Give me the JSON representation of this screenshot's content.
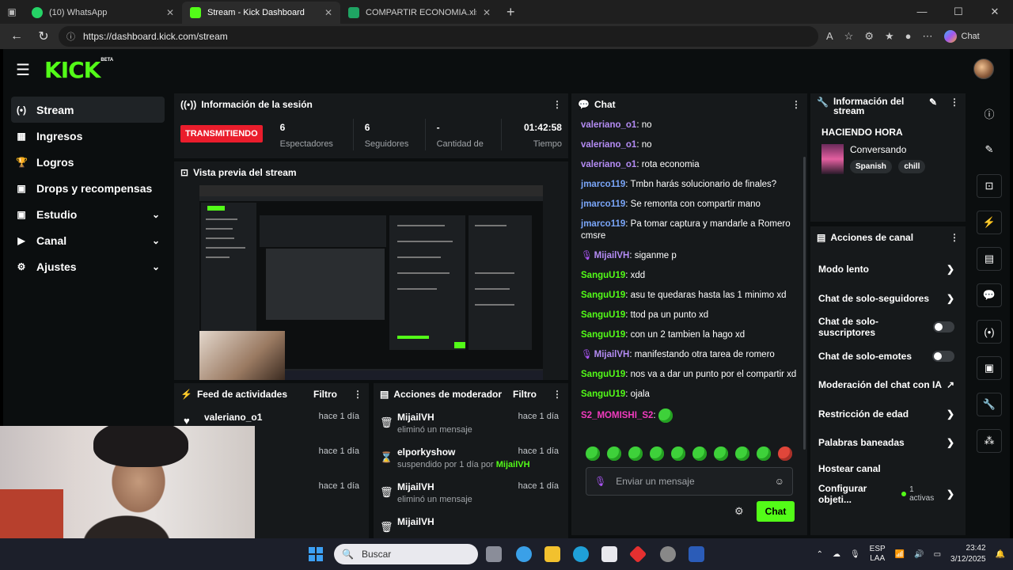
{
  "browser": {
    "tabs": [
      {
        "label": "(10) WhatsApp",
        "color": "#25d366"
      },
      {
        "label": "Stream - Kick Dashboard",
        "color": "#53fc18"
      },
      {
        "label": "COMPARTIR ECONOMIA.xlsx - Ho",
        "color": "#1fa463"
      }
    ],
    "url": "https://dashboard.kick.com/stream",
    "copilot_label": "Chat"
  },
  "kick": {
    "logo": "KICK",
    "beta": "BETA",
    "sidebar": [
      {
        "label": "Stream",
        "icon": "broadcast-icon",
        "glyph": "(•)"
      },
      {
        "label": "Ingresos",
        "icon": "wallet-icon",
        "glyph": "▦"
      },
      {
        "label": "Logros",
        "icon": "trophy-icon",
        "glyph": "🏆"
      },
      {
        "label": "Drops y recompensas",
        "icon": "gift-icon",
        "glyph": "▣"
      },
      {
        "label": "Estudio",
        "icon": "studio-icon",
        "glyph": "▣"
      },
      {
        "label": "Canal",
        "icon": "channel-icon",
        "glyph": "▶"
      },
      {
        "label": "Ajustes",
        "icon": "gear-icon",
        "glyph": "⚙"
      }
    ],
    "session": {
      "title": "Información de la sesión",
      "status": "TRANSMITIENDO",
      "stats": [
        {
          "value": "6",
          "label": "Espectadores"
        },
        {
          "value": "6",
          "label": "Seguidores"
        },
        {
          "value": "-",
          "label": "Cantidad de"
        },
        {
          "value": "01:42:58",
          "label": "Tiempo"
        }
      ]
    },
    "preview": {
      "title": "Vista previa del stream"
    },
    "activity": {
      "title": "Feed de actividades",
      "filter": "Filtro",
      "rows": [
        {
          "who": "valeriano_o1",
          "what": "uir el canal",
          "when": "hace 1 día"
        },
        {
          "who": "",
          "what": "uir el canal",
          "when": "hace 1 día"
        },
        {
          "who": "",
          "what": "uir el canal",
          "when": "hace 1 día"
        },
        {
          "who": "seguidores",
          "what": "",
          "when": ""
        }
      ]
    },
    "modactions": {
      "title": "Acciones de moderador",
      "filter": "Filtro",
      "rows": [
        {
          "who": "MijailVH",
          "what": "eliminó un mensaje",
          "by": "",
          "when": "hace 1 día",
          "icon": "trash-icon",
          "glyph": "🗑"
        },
        {
          "who": "elporkyshow",
          "what": "suspendido por 1 día por ",
          "by": "MijailVH",
          "when": "hace 1 día",
          "icon": "hourglass-icon",
          "glyph": "⌛"
        },
        {
          "who": "MijailVH",
          "what": "eliminó un mensaje",
          "by": "",
          "when": "hace 1 día",
          "icon": "trash-icon",
          "glyph": "🗑"
        },
        {
          "who": "MijailVH",
          "what": "",
          "by": "",
          "when": "",
          "icon": "trash-icon",
          "glyph": "🗑"
        }
      ]
    },
    "chat": {
      "title": "Chat",
      "messages": [
        {
          "user": "valeriano_o1",
          "color": "purple",
          "text": "no",
          "mic": false
        },
        {
          "user": "valeriano_o1",
          "color": "purple",
          "text": "no",
          "mic": false
        },
        {
          "user": "valeriano_o1",
          "color": "purple",
          "text": "rota economia",
          "mic": false
        },
        {
          "user": "jmarco119",
          "color": "blue",
          "text": "Tmbn harás solucionario de finales?",
          "mic": false
        },
        {
          "user": "jmarco119",
          "color": "blue",
          "text": "Se remonta con compartir mano",
          "mic": false
        },
        {
          "user": "jmarco119",
          "color": "blue",
          "text": "Pa tomar captura y mandarle a Romero cmsre",
          "mic": false
        },
        {
          "user": "MijailVH",
          "color": "purple",
          "text": "siganme p",
          "mic": true
        },
        {
          "user": "SanguU19",
          "color": "green",
          "text": "xdd",
          "mic": false
        },
        {
          "user": "SanguU19",
          "color": "green",
          "text": "asu te quedaras hasta las 1 minimo xd",
          "mic": false
        },
        {
          "user": "SanguU19",
          "color": "green",
          "text": "ttod pa un punto xd",
          "mic": false
        },
        {
          "user": "SanguU19",
          "color": "green",
          "text": "con un 2 tambien la hago xd",
          "mic": false
        },
        {
          "user": "MijailVH",
          "color": "purple",
          "text": "manifestando otra tarea de romero",
          "mic": true
        },
        {
          "user": "SanguU19",
          "color": "green",
          "text": "nos va a dar un punto por el compartir xd",
          "mic": false
        },
        {
          "user": "SanguU19",
          "color": "green",
          "text": "ojala",
          "mic": false
        },
        {
          "user": "S2_MOMISHI_S2",
          "color": "pink",
          "text": "",
          "mic": false
        }
      ],
      "placeholder": "Enviar un mensaje",
      "send_label": "Chat"
    },
    "stream_info": {
      "title_line1": "Información del",
      "title_line2": "stream",
      "stream_title": "HACIENDO HORA",
      "category": "Conversando",
      "tags": [
        "Spanish",
        "chill"
      ]
    },
    "channel_actions": {
      "title": "Acciones de canal",
      "rows": [
        {
          "label": "Modo lento",
          "control": "chevron"
        },
        {
          "label": "Chat de solo-seguidores",
          "control": "chevron"
        },
        {
          "label": "Chat de solo-suscriptores",
          "control": "toggle"
        },
        {
          "label": "Chat de solo-emotes",
          "control": "toggle"
        },
        {
          "label": "Moderación del chat con IA",
          "control": "external"
        },
        {
          "label": "Restricción de edad",
          "control": "chevron"
        },
        {
          "label": "Palabras baneadas",
          "control": "chevron"
        },
        {
          "label": "Hostear canal",
          "control": "none"
        },
        {
          "label": "Configurar objeti...",
          "control": "activas"
        }
      ],
      "activas_label": "1 activas"
    }
  },
  "taskbar": {
    "search_placeholder": "Buscar",
    "lang_line1": "ESP",
    "lang_line2": "LAA",
    "time": "23:42",
    "date": "3/12/2025"
  }
}
